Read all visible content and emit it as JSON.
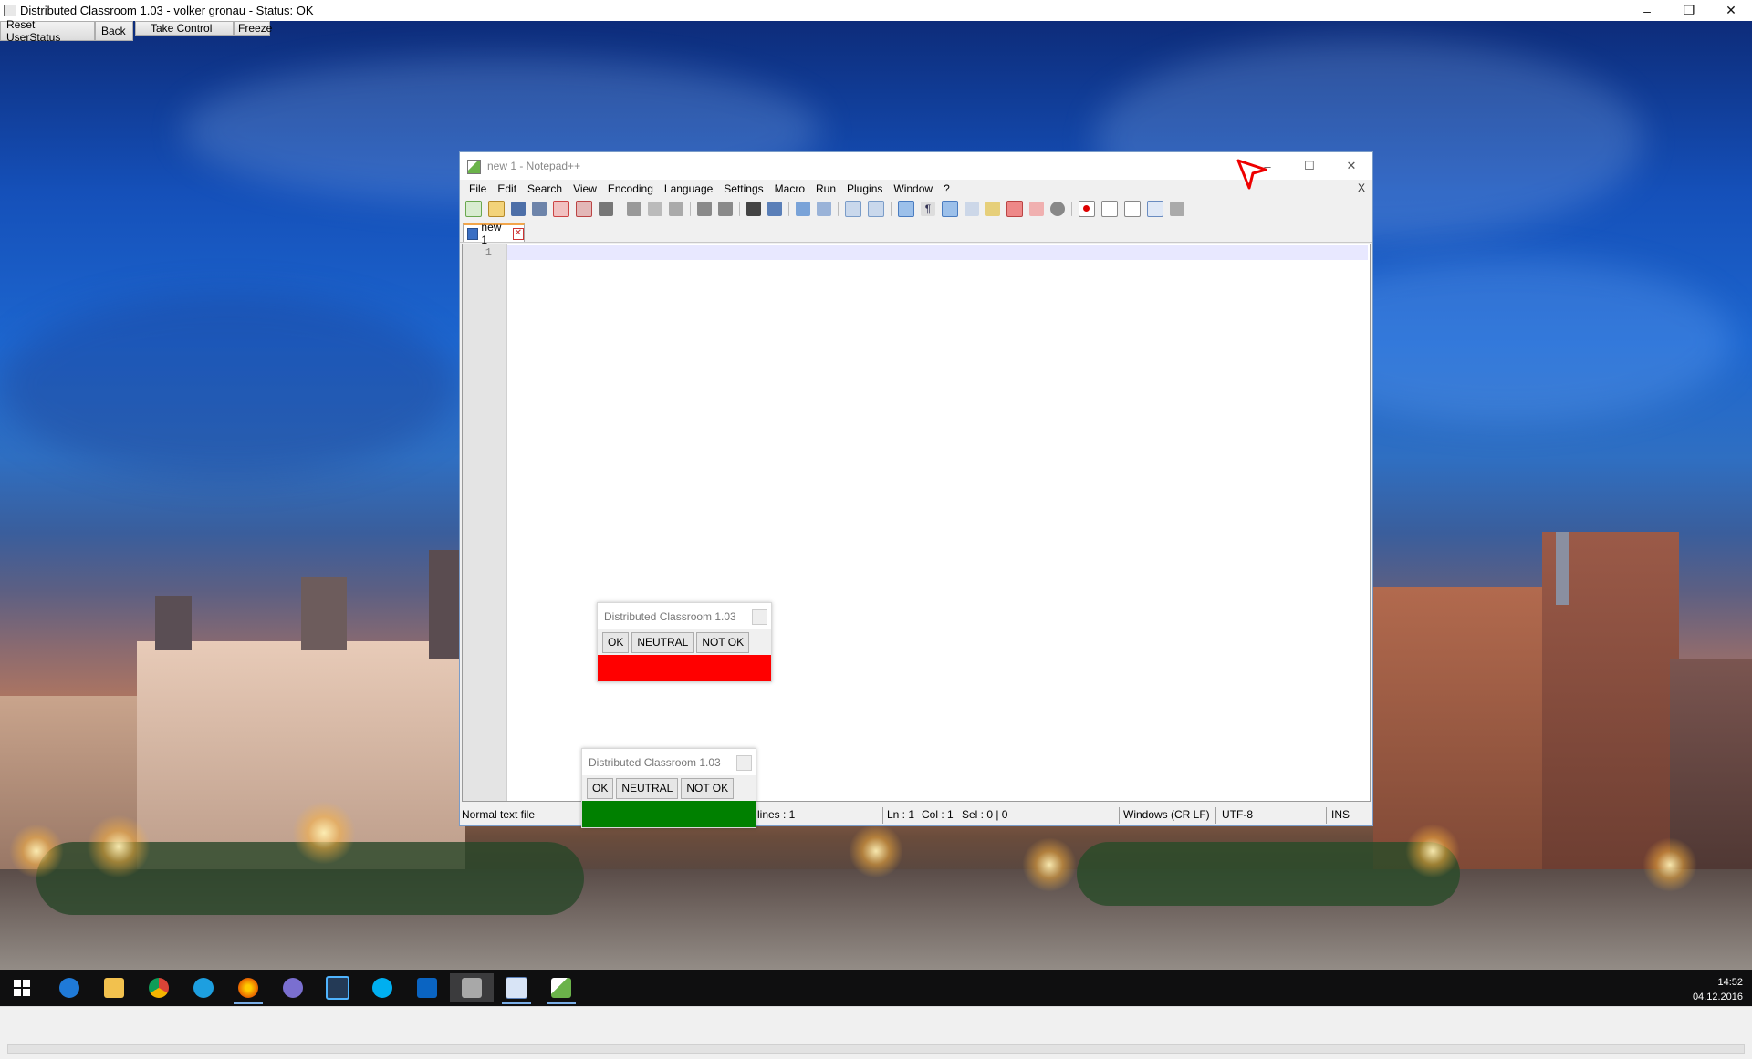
{
  "app": {
    "title": "Distributed Classroom 1.03 - volker gronau - Status: OK",
    "controls": [
      "Reset UserStatus",
      "Back",
      "Take Control",
      "Freeze"
    ]
  },
  "notepad": {
    "title": "new 1 - Notepad++",
    "menu": [
      "File",
      "Edit",
      "Search",
      "View",
      "Encoding",
      "Language",
      "Settings",
      "Macro",
      "Run",
      "Plugins",
      "Window",
      "?"
    ],
    "close_doc": "X",
    "tab_label": "new 1",
    "line_number": "1",
    "status": {
      "filetype": "Normal text file",
      "lines": "lines : 1",
      "ln": "Ln : 1",
      "col": "Col : 1",
      "sel": "Sel : 0 | 0",
      "eol": "Windows (CR LF)",
      "encoding": "UTF-8",
      "mode": "INS"
    }
  },
  "widget_red": {
    "title": "Distributed Classroom 1.03",
    "ok": "OK",
    "neutral": "NEUTRAL",
    "notok": "NOT OK",
    "status_color": "#ff0000"
  },
  "widget_green": {
    "title": "Distributed Classroom 1.03",
    "ok": "OK",
    "neutral": "NEUTRAL",
    "notok": "NOT OK",
    "status_color": "#008000"
  },
  "taskbar": {
    "time": "14:52",
    "date": "04.12.2016",
    "icons": [
      "windows-start",
      "edge",
      "file-explorer",
      "chrome",
      "internet-explorer",
      "firefox",
      "app-generic",
      "app-e",
      "skype",
      "outlook",
      "classroom-app",
      "notepad-app",
      "notepad-plus-plus"
    ]
  }
}
